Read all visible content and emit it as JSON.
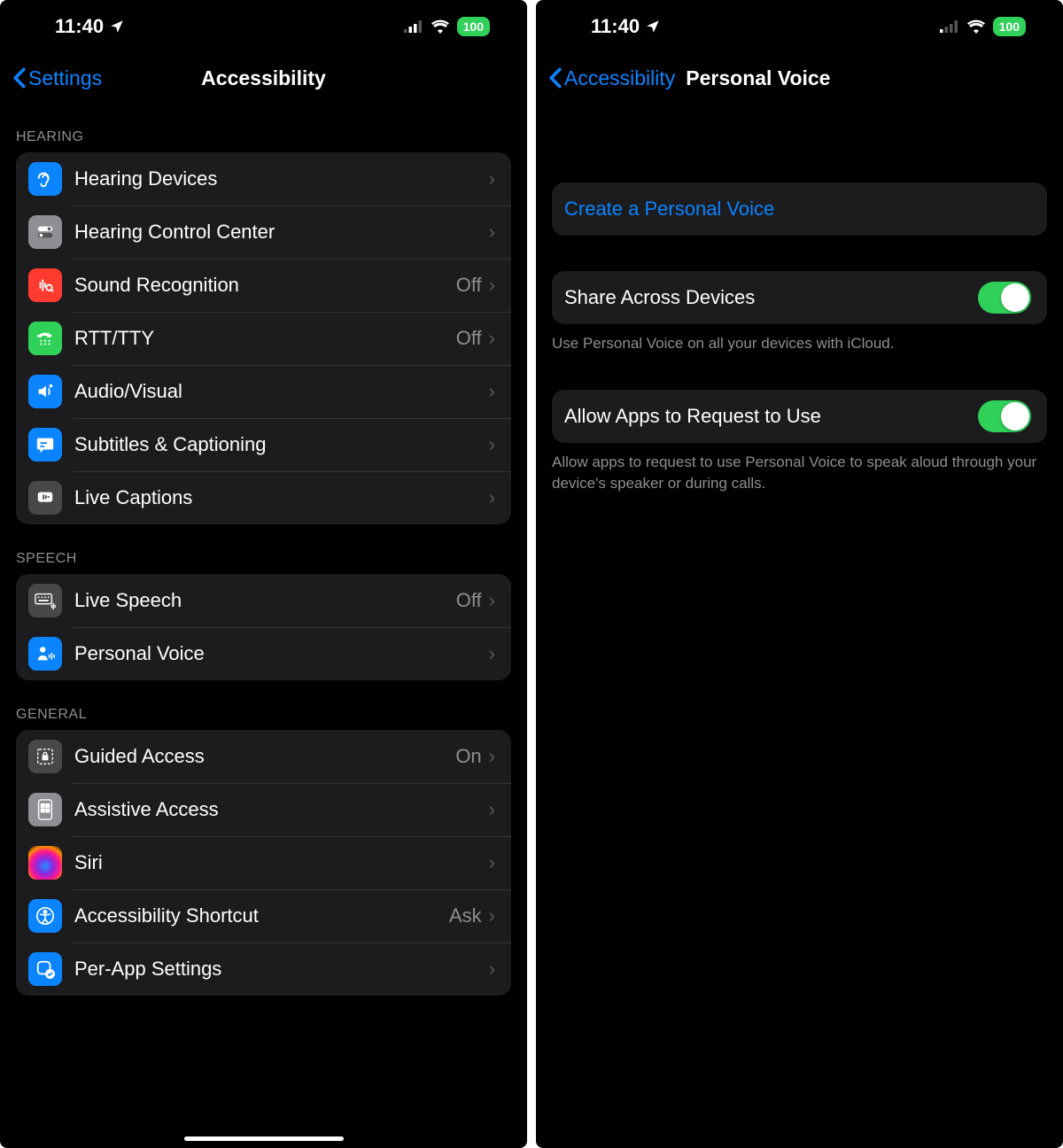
{
  "status": {
    "time": "11:40",
    "battery": "100"
  },
  "left": {
    "back": "Settings",
    "title": "Accessibility",
    "sections": {
      "hearing": {
        "header": "HEARING",
        "items": [
          {
            "label": "Hearing Devices",
            "value": ""
          },
          {
            "label": "Hearing Control Center",
            "value": ""
          },
          {
            "label": "Sound Recognition",
            "value": "Off"
          },
          {
            "label": "RTT/TTY",
            "value": "Off"
          },
          {
            "label": "Audio/Visual",
            "value": ""
          },
          {
            "label": "Subtitles & Captioning",
            "value": ""
          },
          {
            "label": "Live Captions",
            "value": ""
          }
        ]
      },
      "speech": {
        "header": "SPEECH",
        "items": [
          {
            "label": "Live Speech",
            "value": "Off"
          },
          {
            "label": "Personal Voice",
            "value": ""
          }
        ]
      },
      "general": {
        "header": "GENERAL",
        "items": [
          {
            "label": "Guided Access",
            "value": "On"
          },
          {
            "label": "Assistive Access",
            "value": ""
          },
          {
            "label": "Siri",
            "value": ""
          },
          {
            "label": "Accessibility Shortcut",
            "value": "Ask"
          },
          {
            "label": "Per-App Settings",
            "value": ""
          }
        ]
      }
    }
  },
  "right": {
    "back": "Accessibility",
    "title": "Personal Voice",
    "create": "Create a Personal Voice",
    "share": {
      "label": "Share Across Devices",
      "on": true,
      "footer": "Use Personal Voice on all your devices with iCloud."
    },
    "allow": {
      "label": "Allow Apps to Request to Use",
      "on": true,
      "footer": "Allow apps to request to use Personal Voice to speak aloud through your device's speaker or during calls."
    }
  }
}
